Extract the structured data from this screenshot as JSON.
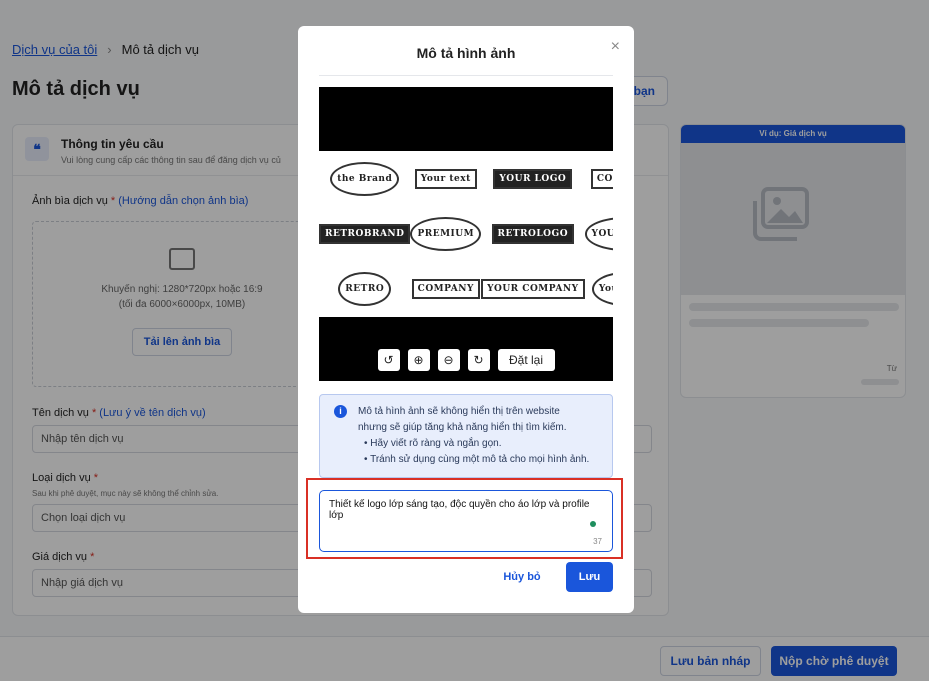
{
  "breadcrumb": {
    "parent": "Dịch vụ của tôi",
    "current": "Mô tả dịch vụ"
  },
  "page": {
    "title": "Mô tả dịch vụ",
    "top_button": "bạn"
  },
  "card": {
    "title": "Thông tin yêu cầu",
    "subtitle": "Vui lòng cung cấp các thông tin sau để đăng dịch vụ củ"
  },
  "form": {
    "cover_label": "Ảnh bìa dịch vụ",
    "cover_hint": "(Hướng dẫn chọn ảnh bìa)",
    "cover_rec_1": "Khuyến nghị: 1280*720px hoặc 16:9",
    "cover_rec_2": "(tối đa 6000×6000px, 10MB)",
    "upload_button": "Tải lên ảnh bìa",
    "name_label": "Tên dịch vụ",
    "name_hint": "(Lưu ý về tên dịch vụ)",
    "name_placeholder": "Nhập tên dịch vụ",
    "type_label": "Loại dịch vụ",
    "type_note": "Sau khi phê duyệt, mục này sẽ không thể chỉnh sửa.",
    "type_placeholder": "Chọn loại dịch vụ",
    "price_label": "Giá dịch vụ",
    "price_placeholder": "Nhập giá dịch vụ",
    "required_mark": "*"
  },
  "preview": {
    "header": "Ví dụ: Giá dịch vụ",
    "price_prefix": "Từ"
  },
  "footer": {
    "draft_button": "Lưu bản nháp",
    "submit_button": "Nộp chờ phê duyệt"
  },
  "modal": {
    "title": "Mô tả hình ảnh",
    "close_icon": "×",
    "logos": [
      "the Brand",
      "Your text",
      "YOUR LOGO",
      "COMPANY",
      "RETROBRAND",
      "PREMIUM",
      "RETROLOGO",
      "YOUR LOGO",
      "RETRO",
      "COMPANY",
      "YOUR COMPANY",
      "Your logo"
    ],
    "controls": {
      "rotate_left": "↺",
      "zoom_in": "⊕",
      "zoom_out": "⊖",
      "rotate_right": "↻",
      "reset": "Đặt lại"
    },
    "info_line_1": "Mô tả hình ảnh sẽ không hiển thị trên website",
    "info_line_2": "nhưng sẽ giúp tăng khả năng hiển thị tìm kiếm.",
    "info_bullet_1": "• Hãy viết rõ ràng và ngắn gọn.",
    "info_bullet_2": "• Tránh sử dụng cùng một mô tả cho mọi hình ảnh.",
    "textarea_value": "Thiết kế logo lớp sáng tạo, độc quyền cho áo lớp và profile lớp",
    "char_count": "37",
    "cancel_button": "Hủy bỏ",
    "save_button": "Lưu"
  },
  "colors": {
    "accent": "#1a56db",
    "highlight_border": "#d93025",
    "info_bg": "#e8eefc"
  }
}
